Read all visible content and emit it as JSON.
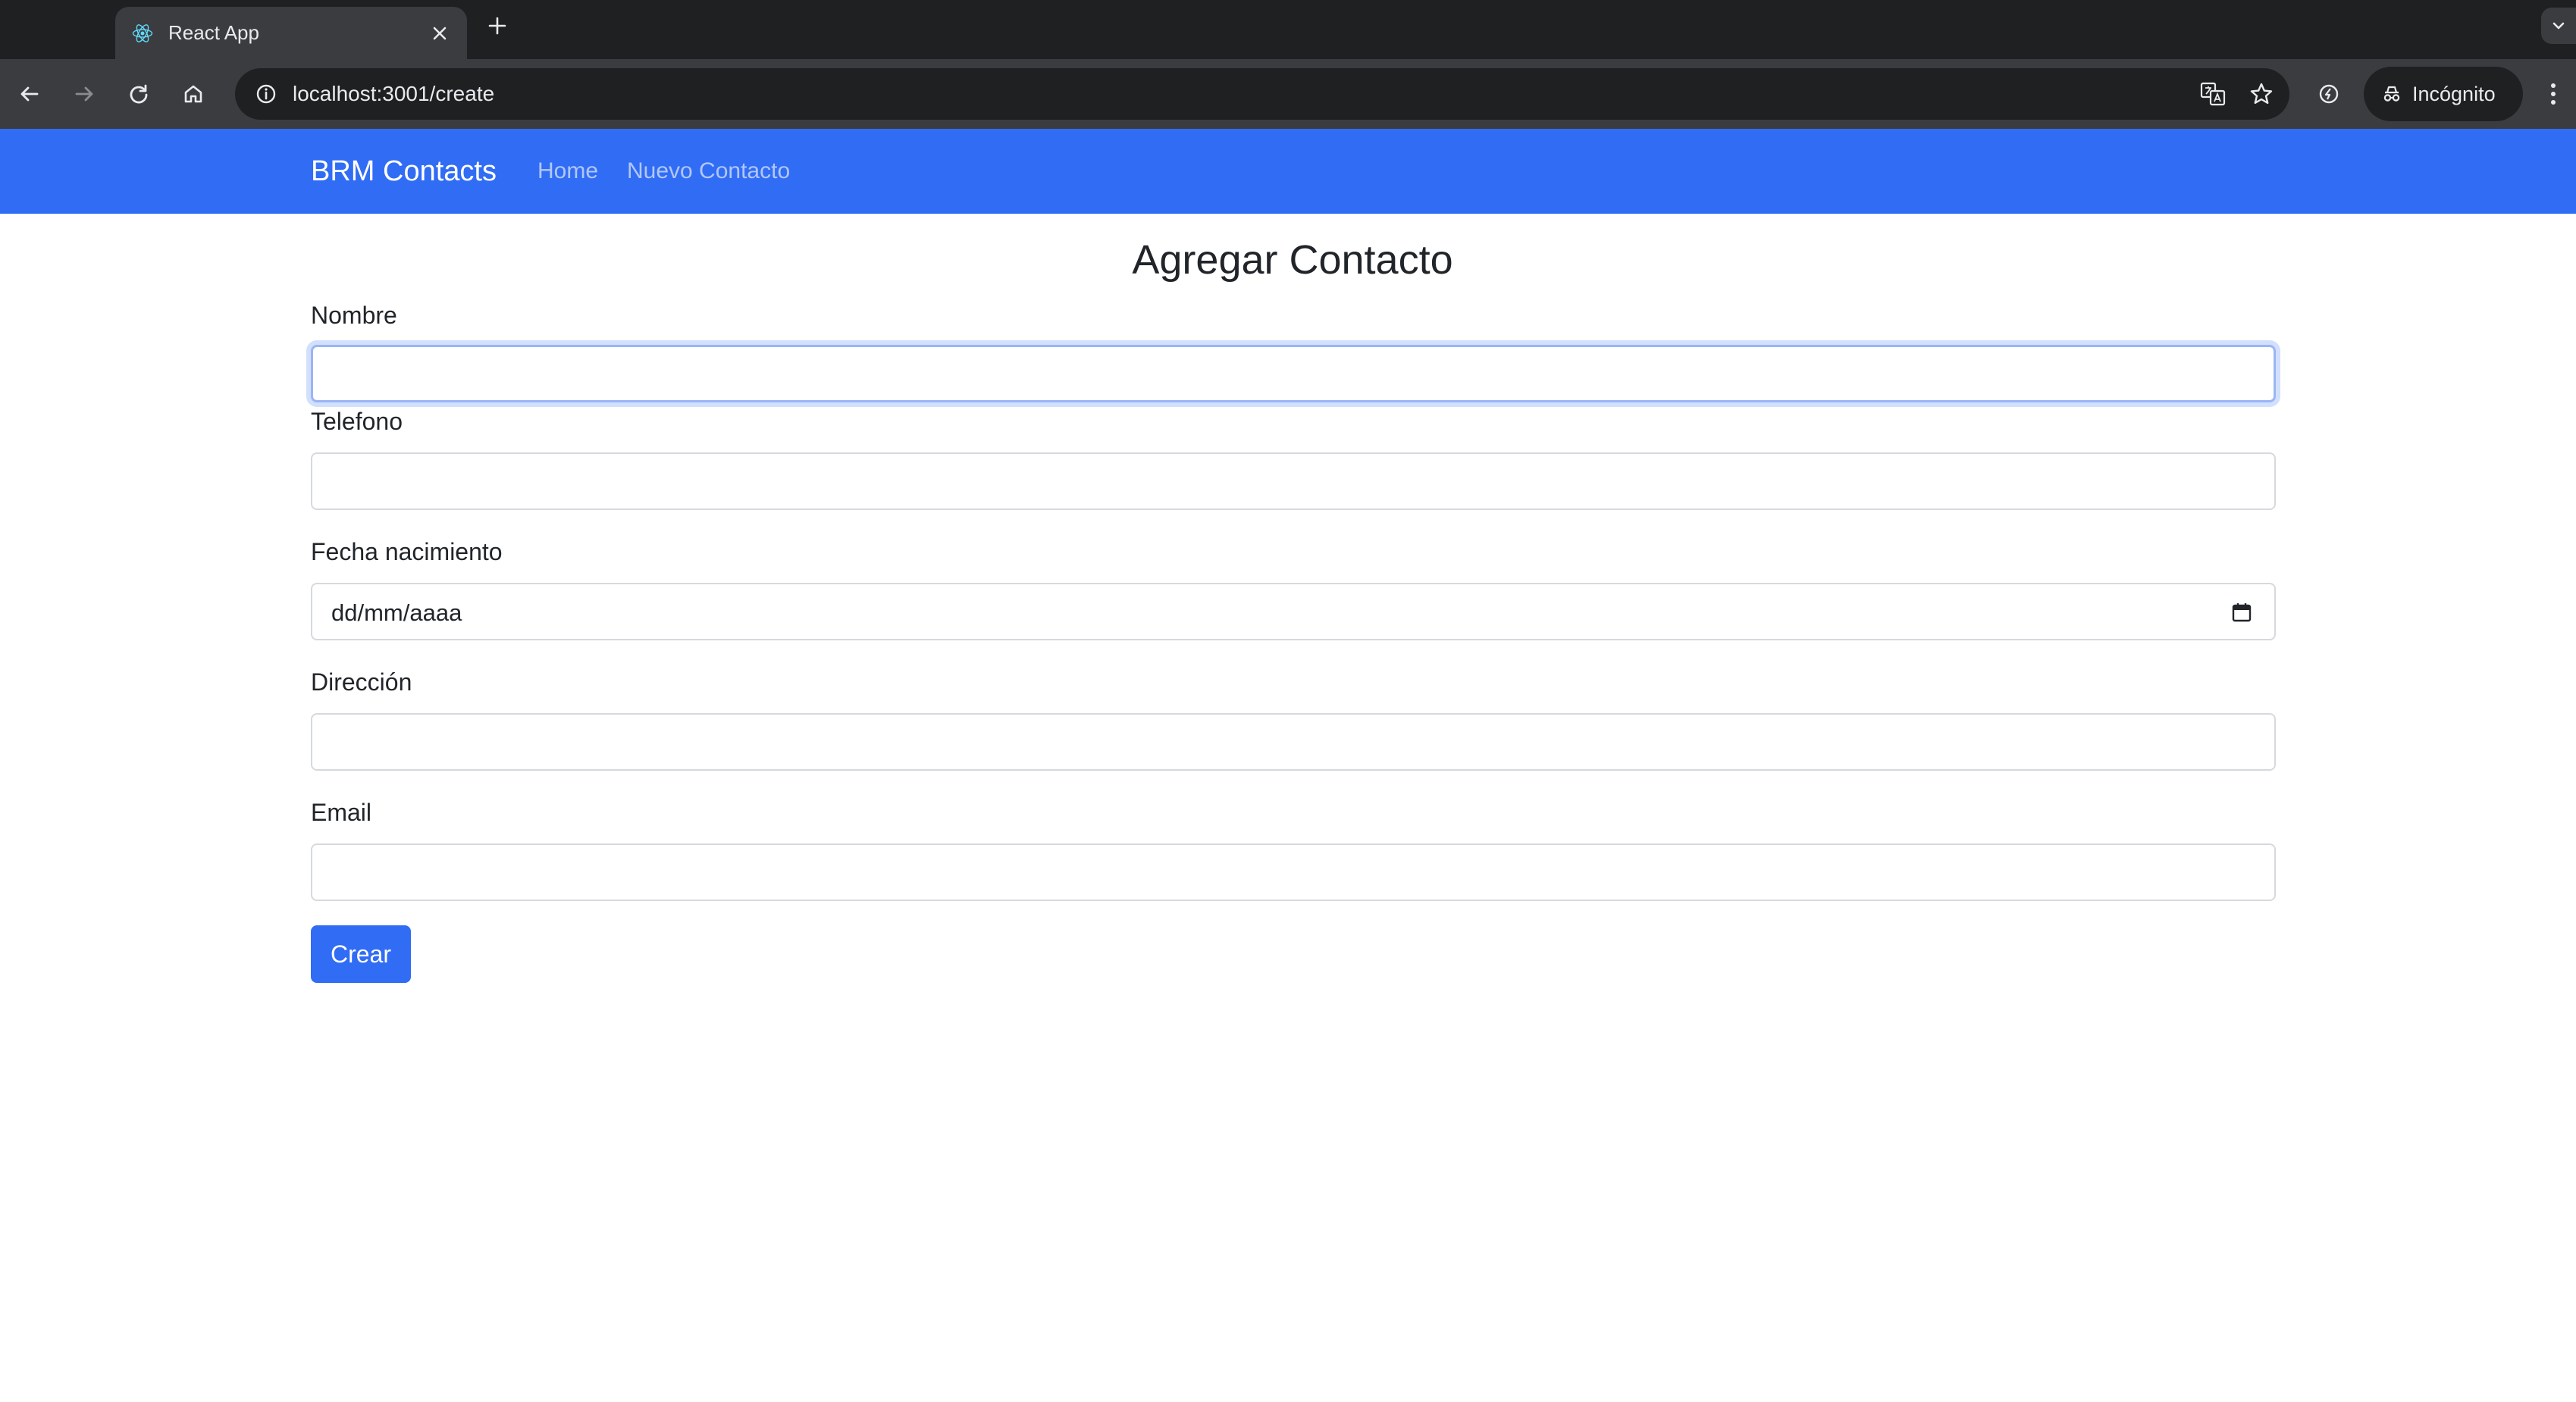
{
  "browser": {
    "tab_title": "React App",
    "url": "localhost:3001/create",
    "profile_label": "Incógnito"
  },
  "navbar": {
    "brand": "BRM Contacts",
    "links": [
      "Home",
      "Nuevo Contacto"
    ]
  },
  "form": {
    "title": "Agregar Contacto",
    "fields": {
      "nombre": {
        "label": "Nombre",
        "value": ""
      },
      "telefono": {
        "label": "Telefono",
        "value": ""
      },
      "fecha": {
        "label": "Fecha nacimiento",
        "placeholder": "dd/mm/aaaa"
      },
      "direccion": {
        "label": "Dirección",
        "value": ""
      },
      "email": {
        "label": "Email",
        "value": ""
      }
    },
    "submit_label": "Crear"
  },
  "colors": {
    "primary": "#316cf4",
    "chrome_dark": "#1f2022",
    "chrome_toolbar": "#3b3c3f"
  }
}
